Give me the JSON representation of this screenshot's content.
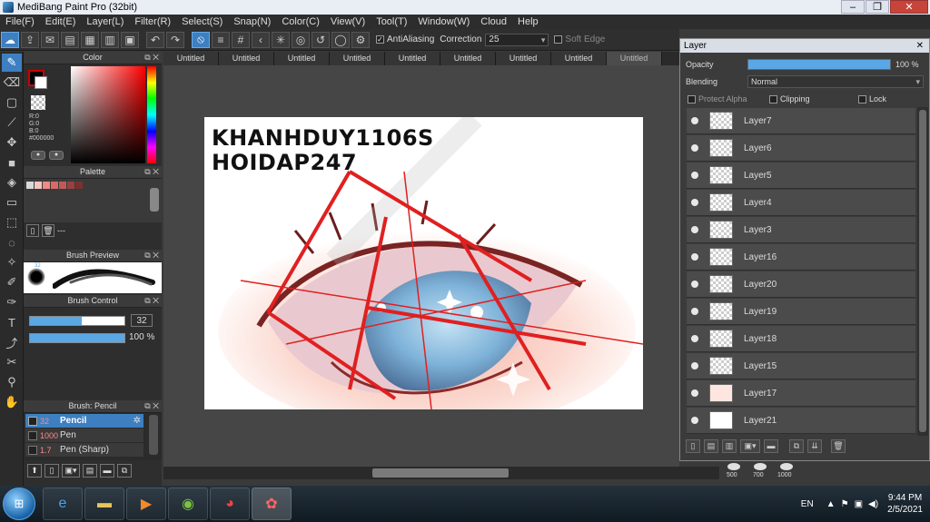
{
  "window": {
    "title": "MediBang Paint Pro (32bit)"
  },
  "menu": [
    "File(F)",
    "Edit(E)",
    "Layer(L)",
    "Filter(R)",
    "Select(S)",
    "Snap(N)",
    "Color(C)",
    "View(V)",
    "Tool(T)",
    "Window(W)",
    "Cloud",
    "Help"
  ],
  "toolbar": {
    "antialiasing_label": "AntiAliasing",
    "correction_label": "Correction",
    "correction_value": "25",
    "soft_edge_label": "Soft Edge"
  },
  "color_panel": {
    "title": "Color",
    "readout_r": "R:0",
    "readout_g": "G:0",
    "readout_b": "B:0",
    "readout_hex": "#000000",
    "foreground": "#000000",
    "accent_red": "#cc0000"
  },
  "palette_panel": {
    "title": "Palette",
    "swatches": [
      "#d9d9d9",
      "#f2c6c0",
      "#f08a84",
      "#d96b66",
      "#c05a5a",
      "#9a4040",
      "#7a3030"
    ],
    "bottom_text": "---"
  },
  "brush_preview": {
    "title": "Brush Preview",
    "size_label": "32"
  },
  "brush_control": {
    "title": "Brush Control",
    "size_value": "32",
    "opacity_value": "100 %",
    "size_fraction": 0.55,
    "opacity_fraction": 1.0
  },
  "brush_list": {
    "title": "Brush: Pencil",
    "items": [
      {
        "size": "32",
        "name": "Pencil",
        "selected": true
      },
      {
        "size": "1000",
        "name": "Pen",
        "selected": false
      },
      {
        "size": "1.7",
        "name": "Pen (Sharp)",
        "selected": false
      }
    ]
  },
  "tabs": [
    "Untitled",
    "Untitled",
    "Untitled",
    "Untitled",
    "Untitled",
    "Untitled",
    "Untitled",
    "Untitled",
    "Untitled"
  ],
  "canvas": {
    "watermark_line1": "KHANHDUY1106S",
    "watermark_line2": "HOIDAP247"
  },
  "layer_window": {
    "title": "Layer",
    "opacity_label": "Opacity",
    "opacity_value": "100 %",
    "blending_label": "Blending",
    "blending_value": "Normal",
    "protect_alpha_label": "Protect Alpha",
    "clipping_label": "Clipping",
    "lock_label": "Lock",
    "layers": [
      "Layer7",
      "Layer6",
      "Layer5",
      "Layer4",
      "Layer3",
      "Layer16",
      "Layer20",
      "Layer19",
      "Layer18",
      "Layer15",
      "Layer17",
      "Layer21"
    ]
  },
  "brush_sizes": [
    "500",
    "700",
    "1000"
  ],
  "taskbar": {
    "language": "EN",
    "time": "9:44 PM",
    "date": "2/5/2021"
  }
}
